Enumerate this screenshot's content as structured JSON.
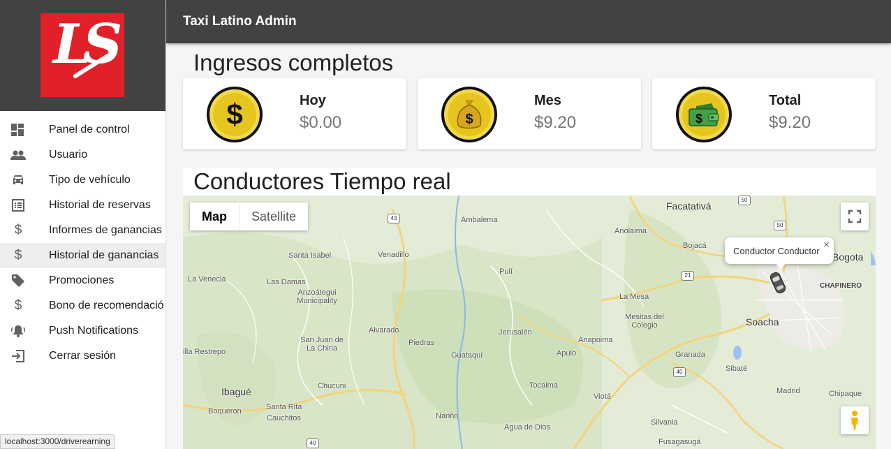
{
  "app": {
    "title": "Taxi Latino Admin",
    "logo_text": "LS"
  },
  "sidebar": {
    "items": [
      {
        "label": "Panel de control",
        "icon": "dashboard-icon"
      },
      {
        "label": "Usuario",
        "icon": "people-icon"
      },
      {
        "label": "Tipo de vehículo",
        "icon": "car-icon"
      },
      {
        "label": "Historial de reservas",
        "icon": "list-icon"
      },
      {
        "label": "Informes de ganancias",
        "icon": "dollar-icon"
      },
      {
        "label": "Historial de ganancias",
        "icon": "dollar-icon",
        "active": true
      },
      {
        "label": "Promociones",
        "icon": "tag-icon"
      },
      {
        "label": "Bono de recomendació",
        "icon": "dollar-icon"
      },
      {
        "label": "Push Notifications",
        "icon": "bell-icon"
      },
      {
        "label": "Cerrar sesión",
        "icon": "logout-icon"
      }
    ]
  },
  "earnings": {
    "title": "Ingresos completos",
    "cards": [
      {
        "label": "Hoy",
        "value": "$0.00",
        "icon": "dollar-coin-icon"
      },
      {
        "label": "Mes",
        "value": "$9.20",
        "icon": "money-bag-coin-icon"
      },
      {
        "label": "Total",
        "value": "$9.20",
        "icon": "wallet-coin-icon"
      }
    ]
  },
  "drivers": {
    "title": "Conductores Tiempo real",
    "map": {
      "type_buttons": [
        "Map",
        "Satellite"
      ],
      "selected_type": "Map",
      "infowindow_text": "Conductor Conductor",
      "places": {
        "facatativa": "Facatativá",
        "anolaima": "Anolaima",
        "bojaca": "Bojacá",
        "bogota": "Bogota",
        "chapinero": "CHAPINERO",
        "ambalema": "Ambalema",
        "santa_isabel": "Santa Isabel",
        "venadillo": "Venadillo",
        "puli": "Pulí",
        "la_venecia": "La Venecia",
        "las_damas": "Las Damas",
        "anzoategui": "Anzoátegui Municipality",
        "la_mesa": "La Mesa",
        "mesitas": "Mesitas del Colegio",
        "soacha": "Soacha",
        "alvarado": "Alvarado",
        "jerusalen": "Jerusalén",
        "anapoima": "Anapoima",
        "san_juan": "San Juan de La China",
        "piedras": "Piedras",
        "guataqui": "Guataquí",
        "apulo": "Apulo",
        "granada": "Granada",
        "sibate": "Sibaté",
        "villa_restrepo": "illa Restrepo",
        "ibague": "Ibagué",
        "chucuni": "Chucuni",
        "tocaima": "Tocaima",
        "viota": "Viotá",
        "madrid": "Madrid",
        "chipaque": "Chipaque",
        "santa_rita": "Santa Rita",
        "boqueron": "Boqueron",
        "cauchitos": "Cauchitos",
        "narino": "Nariño",
        "agua_de_dios": "Agua de Dios",
        "silvania": "Silvania",
        "fusagasuga": "Fusagasugá"
      },
      "road_shields": [
        "43",
        "50",
        "50",
        "21",
        "40",
        "40"
      ]
    }
  },
  "status_bar": {
    "url": "localhost:3000/driverearning"
  }
}
